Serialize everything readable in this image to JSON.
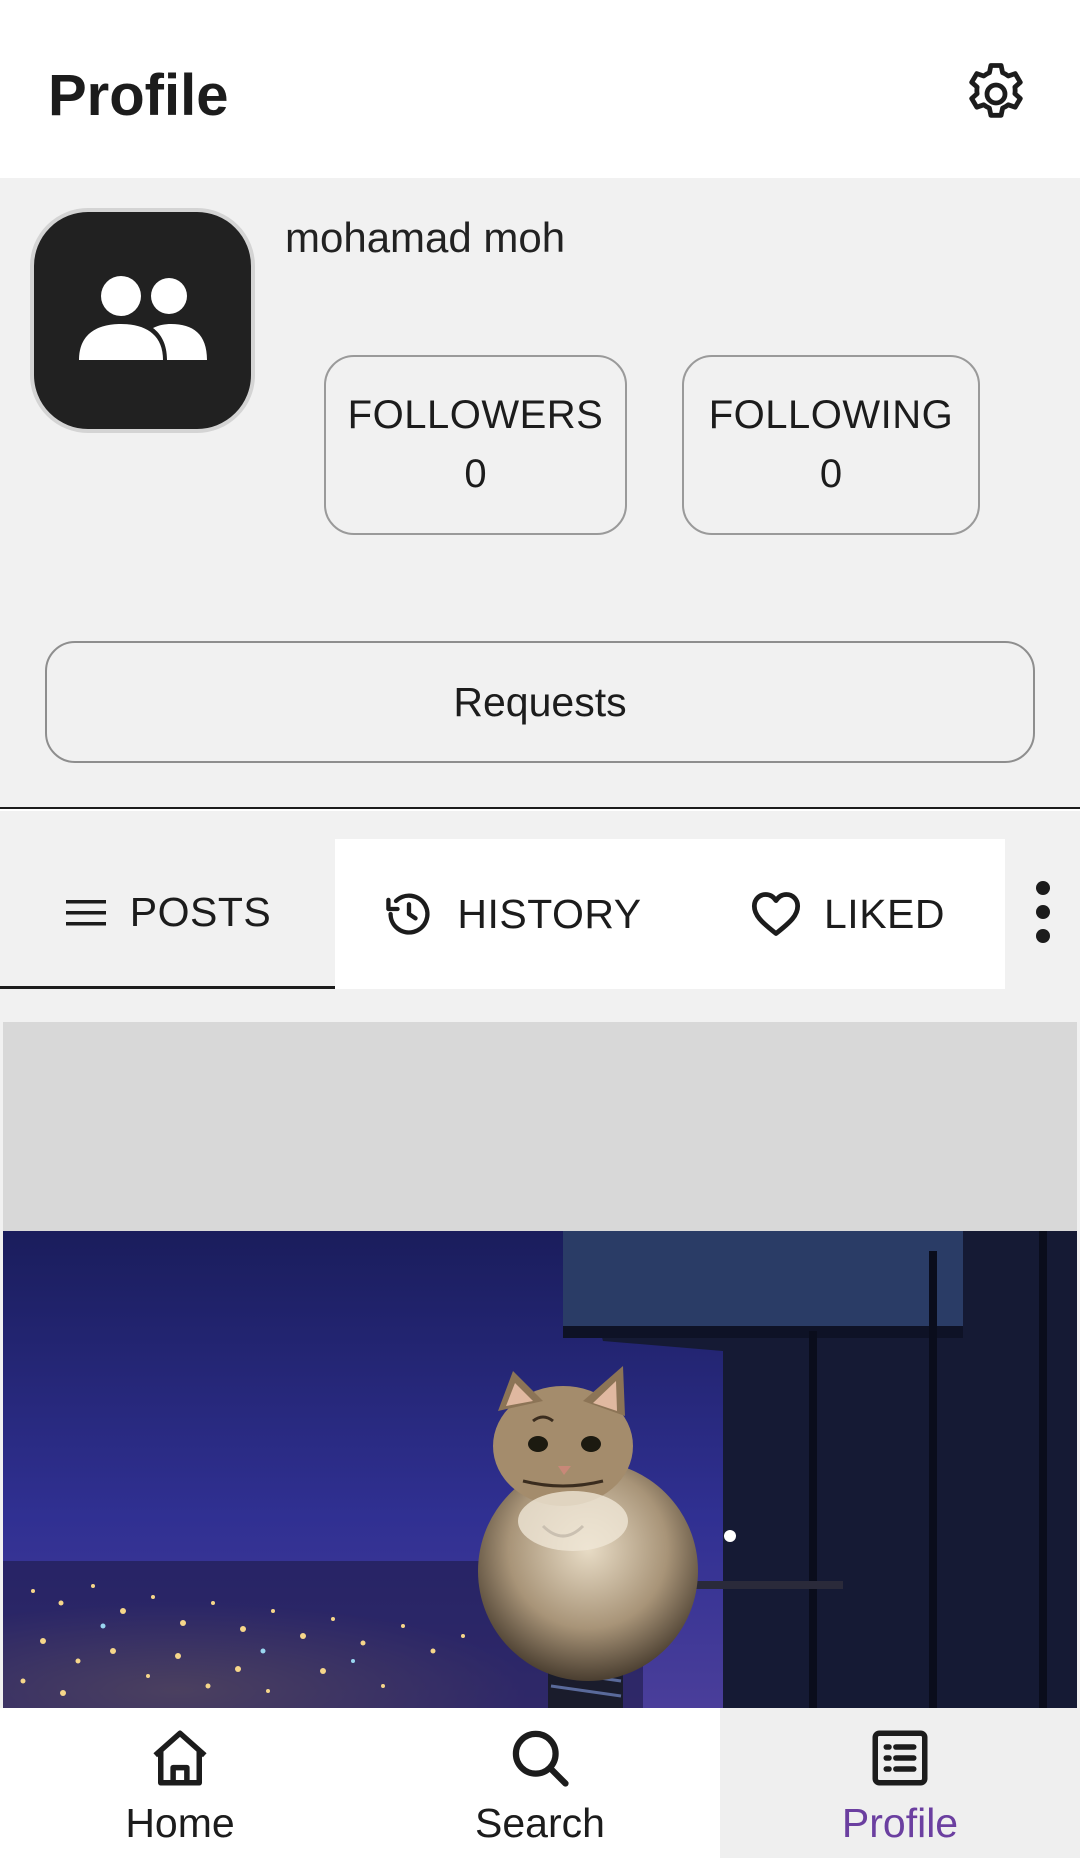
{
  "header": {
    "title": "Profile",
    "settings_icon": "gear-icon"
  },
  "profile": {
    "avatar_icon": "group-icon",
    "username": "mohamad moh",
    "followers": {
      "label": "FOLLOWERS",
      "count": "0"
    },
    "following": {
      "label": "FOLLOWING",
      "count": "0"
    },
    "requests_label": "Requests"
  },
  "tabs": [
    {
      "label": "POSTS",
      "icon": "menu-lines-icon",
      "selected": true
    },
    {
      "label": "HISTORY",
      "icon": "history-icon",
      "selected": false
    },
    {
      "label": "LIKED",
      "icon": "heart-icon",
      "selected": false
    }
  ],
  "more_icon": "more-vertical-icon",
  "post": {
    "image_subject": "cat on railing over night city"
  },
  "bottom_nav": [
    {
      "label": "Home",
      "icon": "home-icon",
      "selected": false
    },
    {
      "label": "Search",
      "icon": "search-icon",
      "selected": false
    },
    {
      "label": "Profile",
      "icon": "list-icon",
      "selected": true
    }
  ],
  "colors": {
    "accent": "#6b3fa0",
    "surface": "#f1f1f1",
    "avatar_bg": "#212121"
  }
}
